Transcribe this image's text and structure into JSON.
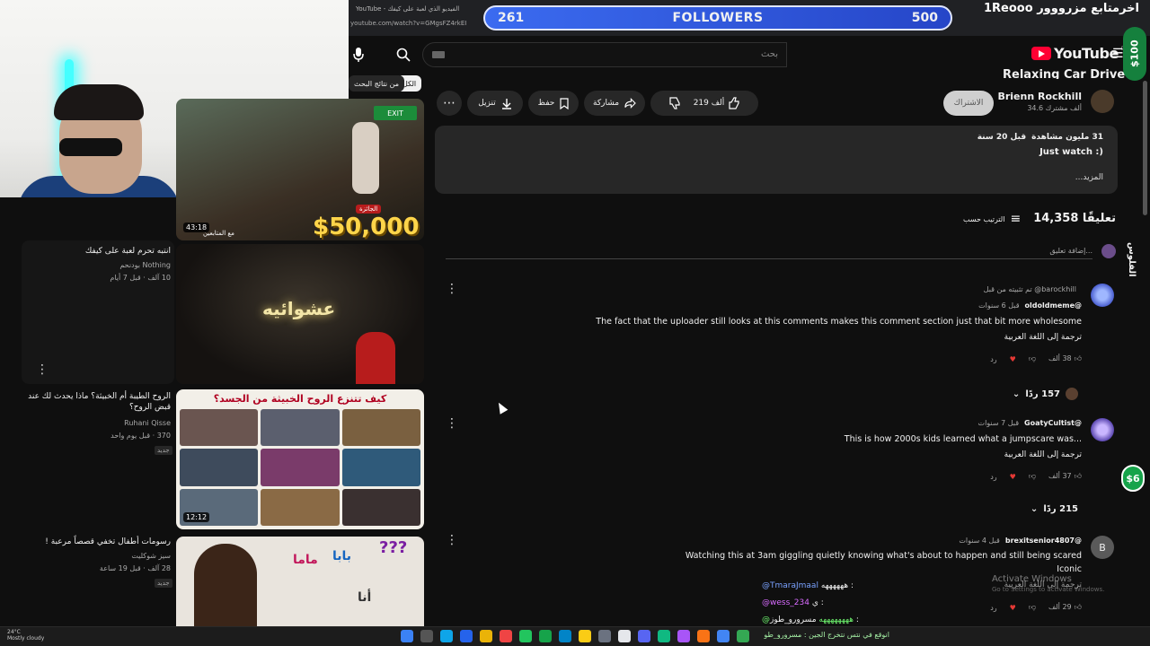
{
  "browser": {
    "tab_title": "YouTube - الفيديو الذي لعبة على كيفك",
    "url": "youtube.com/watch?v=GMgsFZ4rkEI"
  },
  "overlay": {
    "followers_label": "FOLLOWERS",
    "followers_current": "261",
    "followers_goal": "500",
    "channel_title": "1Reooo اخرمتابع مزرووور",
    "money_top": "$100",
    "money_mid": "$6",
    "money_side_label": "الفلوس",
    "activate_title": "Activate Windows",
    "activate_sub": "Go to Settings to activate Windows.",
    "chat": [
      {
        "user": "@TmaraJmaal",
        "text": "ههههههه :"
      },
      {
        "user": "@wess_234",
        "text": "ي :"
      },
      {
        "user": "@ههههههههه",
        "text": "مسرورو_طوز :"
      }
    ],
    "ticker": "انوقع في نتس نتخرج الجين : مسرورو_طوز"
  },
  "header": {
    "logo_text": "YouTube",
    "logo_region": "DE",
    "search_placeholder": "بحث"
  },
  "filters": {
    "all": "الكل",
    "from_results": "من نتائج البحث"
  },
  "video": {
    "title": "Relaxing Car Drive",
    "channel": "Brienn Rockhill",
    "subscribers": "34.6 ألف مشترك",
    "subscribe_label": "الاشتراك",
    "likes": "219 ألف",
    "share": "مشاركة",
    "save": "حفظ",
    "download": "تنزيل",
    "views": "31 مليون مشاهدة",
    "age": "قبل 20 سنة",
    "description": "Just watch :)",
    "more": "...المزيد"
  },
  "comments_header": {
    "count": "14,358 تعليقًا",
    "sort": "الترتيب حسب",
    "add_placeholder": "إضافة تعليق..."
  },
  "comments": [
    {
      "pinned": "تم تثبيته من قبل @barockhill",
      "user": "@oldoldmeme",
      "time": "قبل 6 سنوات",
      "text": "The fact that the uploader still looks at this comments makes this comment section just that bit more wholesome",
      "translate": "ترجمة إلى اللغة العربية",
      "likes": "38 ألف",
      "reply": "رد",
      "replies": "157 ردًا"
    },
    {
      "user": "@GoatyCultist",
      "time": "قبل 7 سنوات",
      "text": "This is how 2000s kids learned what a jumpscare was...",
      "translate": "ترجمة إلى اللغة العربية",
      "likes": "37 ألف",
      "reply": "رد",
      "replies": "215 ردًا"
    },
    {
      "user": "@brexitsenior4807",
      "avatar_letter": "B",
      "time": "قبل 4 سنوات",
      "text": "Watching this at 3am giggling quietly knowing what's about to happen and still being scared",
      "text2": "Iconic",
      "translate": "ترجمة إلى اللغة العربية",
      "likes": "29 ألف",
      "reply": "رد"
    }
  ],
  "related": [
    {
      "thumb_text": "الجائزة",
      "prize": "$50,000",
      "duration": "43:18",
      "thumb_caption": "مع المتابعين"
    },
    {
      "title": "انتبه تحرم لعبة على كيفك",
      "channel": "Nothing بودنحم",
      "meta": "10 آلف · قبل 7 أيام",
      "thumb_text": "عشوائيه"
    },
    {
      "title": "الروح الطيبة أم الخبيثة؟ ماذا يحدث لك عند قبض الروح؟",
      "channel": "Ruhani Qisse",
      "meta": "370 · قبل يوم واحد",
      "badge": "جديد",
      "thumb_text": "كيف تتنزع الروح الخبيثة من الجسد؟",
      "duration": "12:12"
    },
    {
      "title": "رسومات أطفال تخفي قصصاً مرعبة !",
      "channel": "سيز شوكليت",
      "meta": "28 آلف · قبل 19 ساعة",
      "badge": "جديد",
      "thumb_text_left": "بابا",
      "thumb_text_mid": "ماما",
      "thumb_text_bottom": "أنا",
      "thumb_q": "???"
    }
  ],
  "taskbar": {
    "weather": "24°C",
    "weather_sub": "Mostly cloudy"
  },
  "colors": {
    "background": "#0f0f0f",
    "surface": "#272727",
    "followers_bar": "#2f56e0",
    "youtube_red": "#ff0033",
    "money_green": "#16a34a"
  }
}
